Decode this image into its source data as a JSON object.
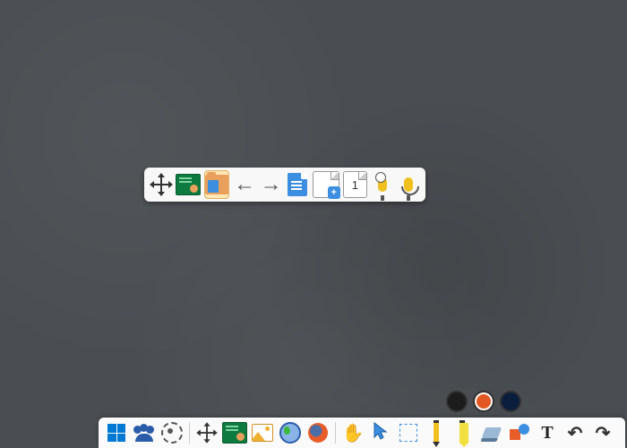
{
  "floating_toolbar": {
    "buttons": [
      {
        "name": "move-handle",
        "interactable": true
      },
      {
        "name": "blackboard-tool",
        "interactable": true
      },
      {
        "name": "open-document",
        "interactable": true,
        "selected": true
      },
      {
        "name": "previous-page",
        "interactable": true
      },
      {
        "name": "next-page",
        "interactable": true
      },
      {
        "name": "document-view",
        "interactable": true
      },
      {
        "name": "add-page",
        "interactable": true
      },
      {
        "name": "web-microphone",
        "interactable": true
      },
      {
        "name": "microphone",
        "interactable": true
      }
    ],
    "page_number": "1",
    "add_page_label": "+"
  },
  "color_picker": {
    "colors": [
      {
        "hex": "#1c1c1c",
        "name": "color-black",
        "selected": false
      },
      {
        "hex": "#e25822",
        "name": "color-orange",
        "selected": true
      },
      {
        "hex": "#0b1e3d",
        "name": "color-navy",
        "selected": false
      }
    ]
  },
  "bottom_toolbar": {
    "buttons": [
      {
        "name": "start-menu",
        "interactable": true
      },
      {
        "name": "classroom-button",
        "interactable": true
      },
      {
        "name": "settings-button",
        "interactable": true
      },
      {
        "name": "move-tool",
        "interactable": true
      },
      {
        "name": "toggle-board",
        "interactable": true
      },
      {
        "name": "insert-image",
        "interactable": true
      },
      {
        "name": "world-button",
        "interactable": true
      },
      {
        "name": "browser-button",
        "interactable": true
      },
      {
        "name": "pan-tool",
        "interactable": true
      },
      {
        "name": "pointer-tool",
        "interactable": true
      },
      {
        "name": "select-tool",
        "interactable": true
      },
      {
        "name": "pen-tool",
        "interactable": true
      },
      {
        "name": "highlighter-tool",
        "interactable": true
      },
      {
        "name": "eraser-tool",
        "interactable": true
      },
      {
        "name": "shapes-tool",
        "interactable": true
      },
      {
        "name": "text-tool",
        "interactable": true,
        "label": "T"
      },
      {
        "name": "undo-button",
        "interactable": true
      },
      {
        "name": "redo-button",
        "interactable": true
      }
    ]
  }
}
